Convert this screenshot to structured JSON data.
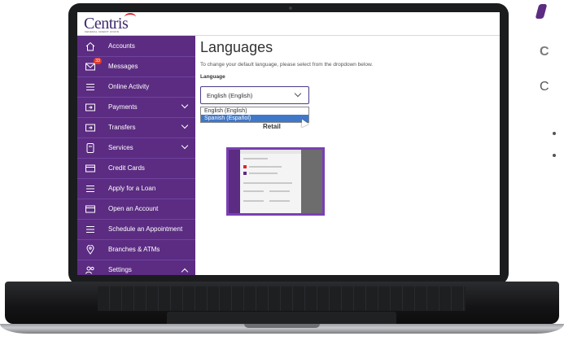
{
  "logo": {
    "name": "Centris",
    "subtitle": "FEDERAL CREDIT UNION"
  },
  "sidebar": {
    "items": [
      {
        "label": "Accounts",
        "icon": "home-icon"
      },
      {
        "label": "Messages",
        "icon": "envelope-icon",
        "badge": "33"
      },
      {
        "label": "Online Activity",
        "icon": "list-icon"
      },
      {
        "label": "Payments",
        "icon": "card-arrow-icon",
        "chevron": "down"
      },
      {
        "label": "Transfers",
        "icon": "card-arrow-icon",
        "chevron": "down"
      },
      {
        "label": "Services",
        "icon": "document-icon",
        "chevron": "down"
      },
      {
        "label": "Credit Cards",
        "icon": "credit-card-icon"
      },
      {
        "label": "Apply for a Loan",
        "icon": "list-icon"
      },
      {
        "label": "Open an Account",
        "icon": "credit-card-icon"
      },
      {
        "label": "Schedule an Appointment",
        "icon": "list-icon"
      },
      {
        "label": "Branches & ATMs",
        "icon": "location-pin-icon"
      },
      {
        "label": "Settings",
        "icon": "users-icon",
        "chevron": "up"
      }
    ]
  },
  "main": {
    "title": "Languages",
    "description": "To change your default language, please select from the dropdown below.",
    "language_label": "Language",
    "selected_value": "English (English)",
    "options": [
      "English (English)",
      "Spanish (Español)"
    ],
    "highlighted_option": "Spanish (Español)",
    "section_heading": "Retail"
  },
  "slide_right": {
    "letter_1": "C",
    "letter_2": "C"
  },
  "colors": {
    "brand_purple": "#5b2c82",
    "badge_red": "#e23a2d",
    "highlight_blue": "#3f78c9"
  }
}
